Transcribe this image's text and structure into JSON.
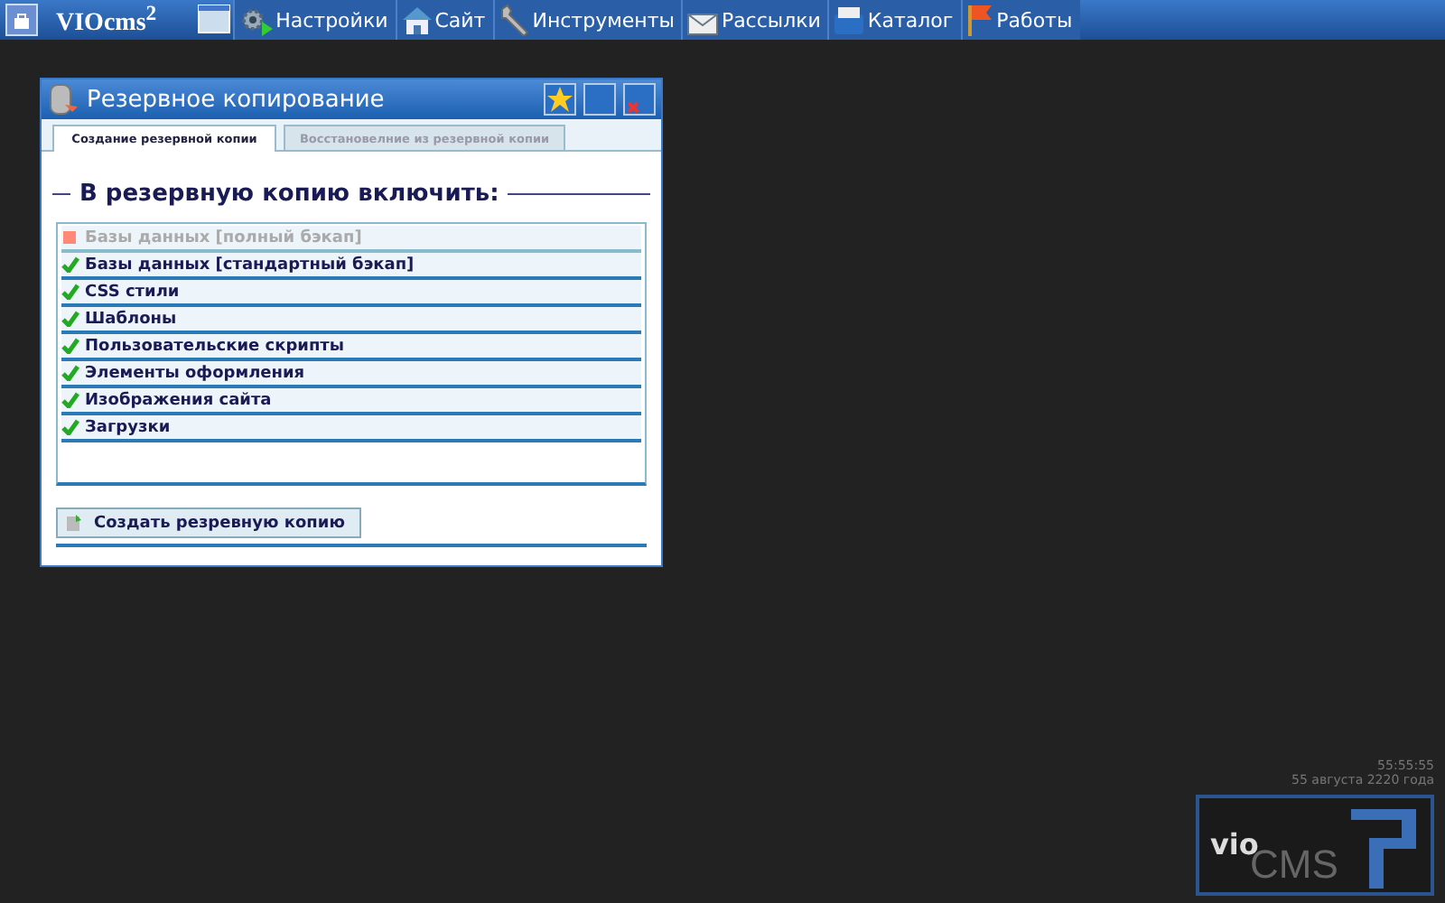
{
  "taskbar": {
    "logo": "VIOcms$^{2}$",
    "items": [
      {
        "label": "Настройки"
      },
      {
        "label": "Сайт"
      },
      {
        "label": "Инструменты"
      },
      {
        "label": "Рассылки"
      },
      {
        "label": "Каталог"
      },
      {
        "label": "Работы"
      }
    ]
  },
  "window": {
    "title": "Резервное копирование",
    "tabs": [
      {
        "label": "Создание резервной копии",
        "selected": true
      },
      {
        "label": "Восстановелние из резервной копии",
        "selected": false
      }
    ],
    "heading": "В резервную копию включить:",
    "options": [
      {
        "label": "Базы данных [полный бэкап]",
        "checked": false
      },
      {
        "label": "Базы данных [стандартный бэкап]",
        "checked": true
      },
      {
        "label": "CSS стили",
        "checked": true
      },
      {
        "label": "Шаблоны",
        "checked": true
      },
      {
        "label": "Пользовательские скрипты",
        "checked": true
      },
      {
        "label": "Элементы оформления",
        "checked": true
      },
      {
        "label": "Изображения сайта",
        "checked": true
      },
      {
        "label": "Загрузки",
        "checked": true
      }
    ],
    "button": "Создать резревную копию"
  },
  "clock": {
    "time": "55:55:55",
    "date": "55 августа 2220 года"
  },
  "brand": {
    "left": "vio",
    "right": "CMS"
  }
}
